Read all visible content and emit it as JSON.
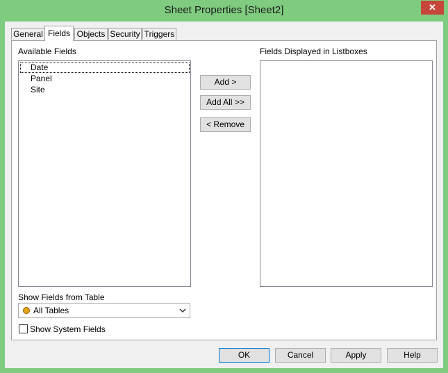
{
  "window": {
    "title": "Sheet Properties [Sheet2]",
    "close_glyph": "✕"
  },
  "tabs": [
    {
      "label": "General"
    },
    {
      "label": "Fields"
    },
    {
      "label": "Objects"
    },
    {
      "label": "Security"
    },
    {
      "label": "Triggers"
    }
  ],
  "active_tab": "Fields",
  "available": {
    "label": "Available Fields",
    "items": [
      "Date",
      "Panel",
      "Site"
    ]
  },
  "displayed": {
    "label": "Fields Displayed in Listboxes",
    "items": []
  },
  "actions": {
    "add": "Add >",
    "add_all": "Add All >>",
    "remove": "< Remove"
  },
  "show_from": {
    "label": "Show Fields from Table",
    "selected": "All Tables"
  },
  "system_fields": {
    "label": "Show System Fields",
    "checked": false
  },
  "footer": {
    "ok": "OK",
    "cancel": "Cancel",
    "apply": "Apply",
    "help": "Help"
  },
  "colors": {
    "frame": "#7fcb7f",
    "close": "#c7463c",
    "accent": "#0078d7"
  }
}
